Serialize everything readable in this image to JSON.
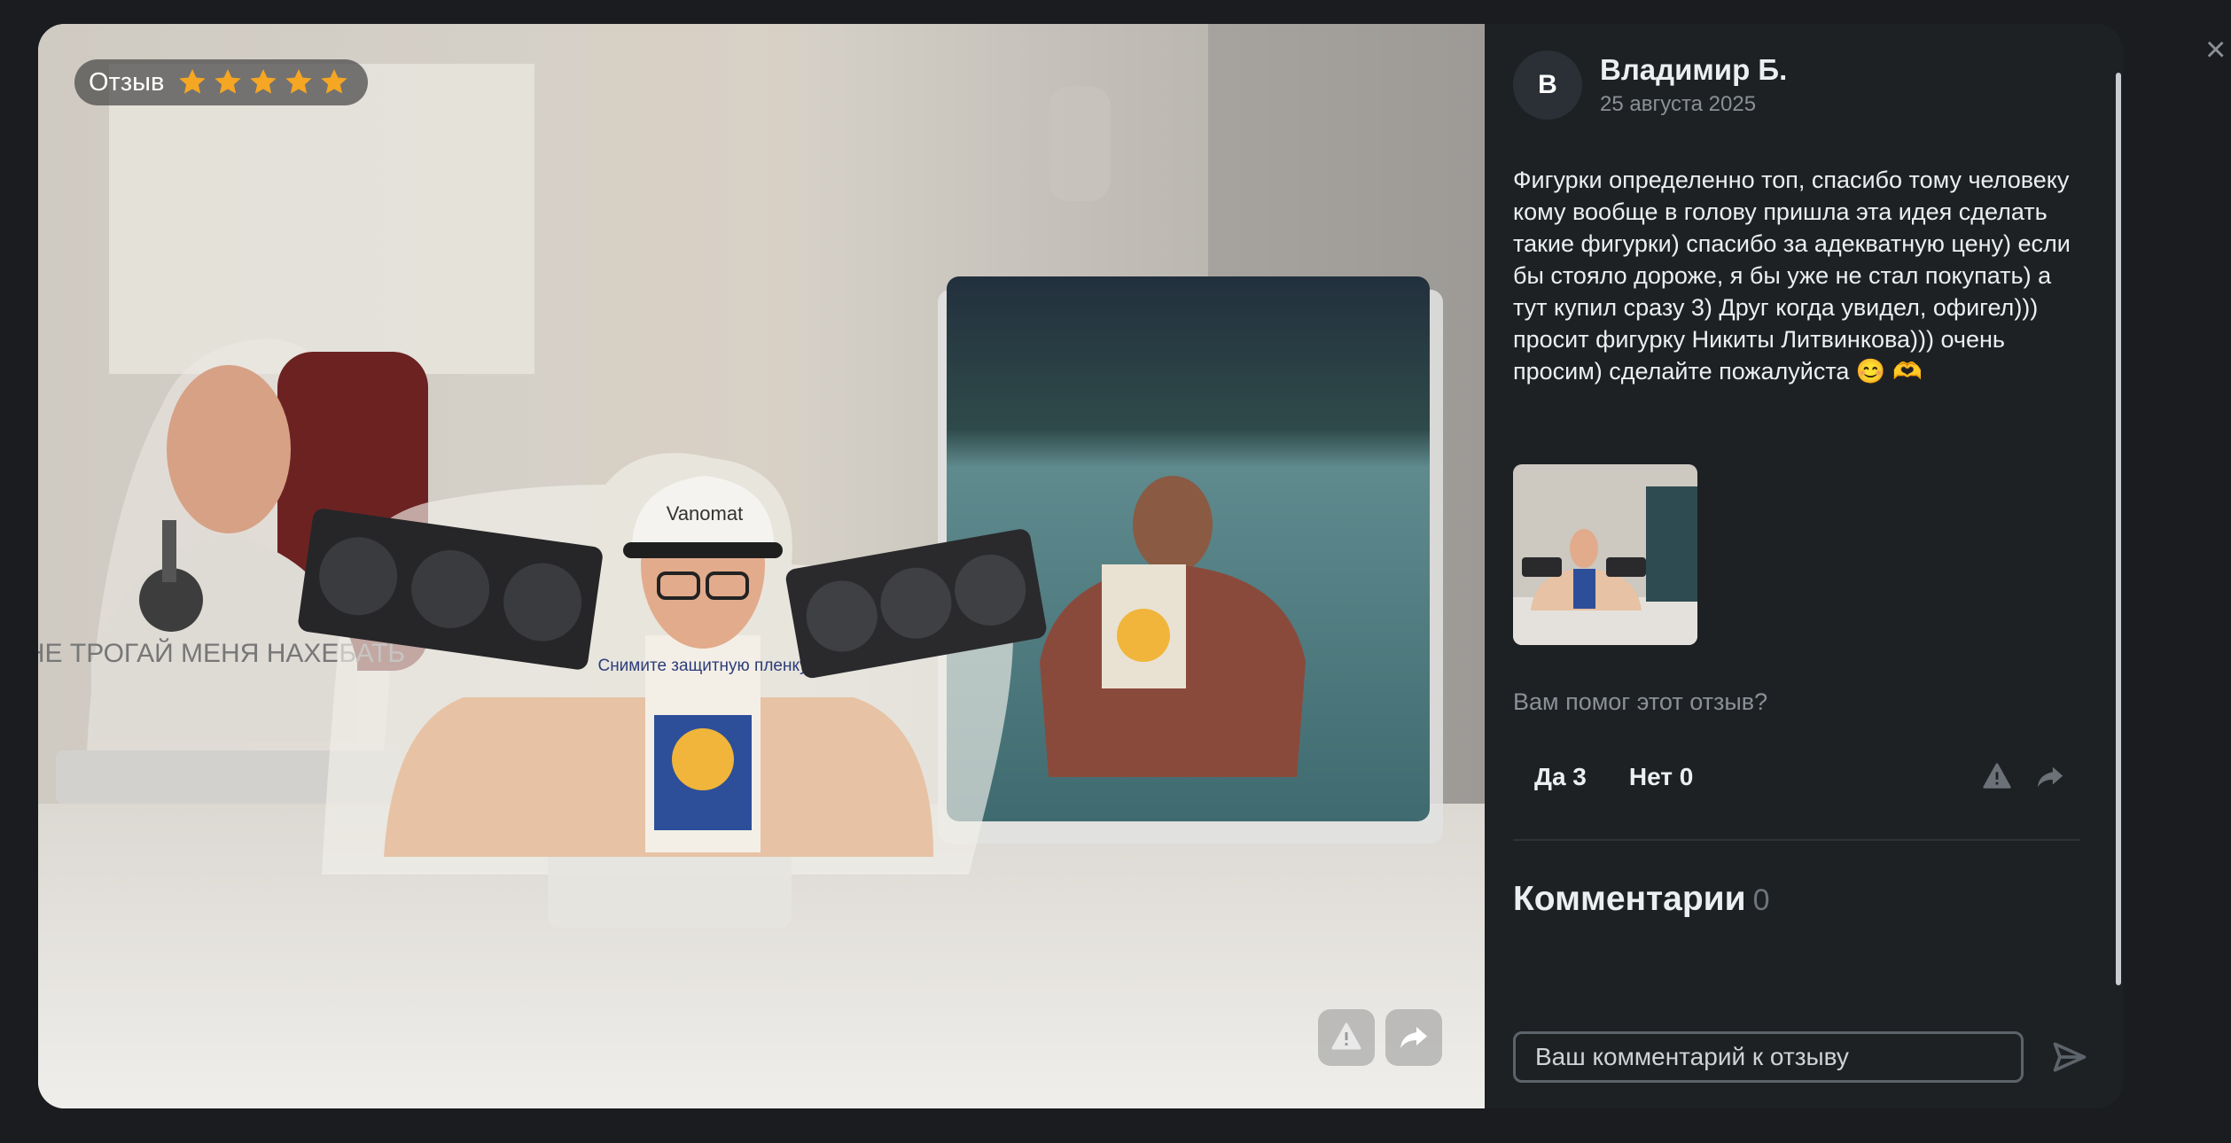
{
  "review": {
    "badge_label": "Отзыв",
    "rating": 5,
    "rating_max": 5,
    "author_initial": "В",
    "author_name": "Владимир Б.",
    "date": "25 августа 2025",
    "text": "Фигурки определенно топ, спасибо тому человеку кому вообще в голову пришла эта идея сделать такие фигурки) спасибо за адекватную цену) если бы стояло дороже, я бы уже не стал покупать) а тут купил сразу 3) Друг когда увидел, офигел))) просит фигурку Никиты Литвинкова))) очень просим) сделайте пожалуйста 😊 🫶"
  },
  "photo": {
    "figure_sign_text": "Снимите защитную пленку",
    "cap_text": "Vanomat",
    "shirt_text": "НЕ ТРОГАЙ МЕНЯ НАХЕБАТЬ"
  },
  "helpful": {
    "question": "Вам помог этот отзыв?",
    "yes_label": "Да 3",
    "no_label": "Нет 0"
  },
  "comments": {
    "title": "Комментарии",
    "count": "0",
    "input_placeholder": "Ваш комментарий к отзыву"
  },
  "close_symbol": "×",
  "colors": {
    "star": "#f5a623",
    "panel_bg": "#1e2124",
    "page_bg": "#1a1c1f",
    "muted_text": "#8b9097"
  },
  "icons": [
    "star-icon",
    "report-icon",
    "share-icon",
    "send-icon",
    "close-icon"
  ]
}
